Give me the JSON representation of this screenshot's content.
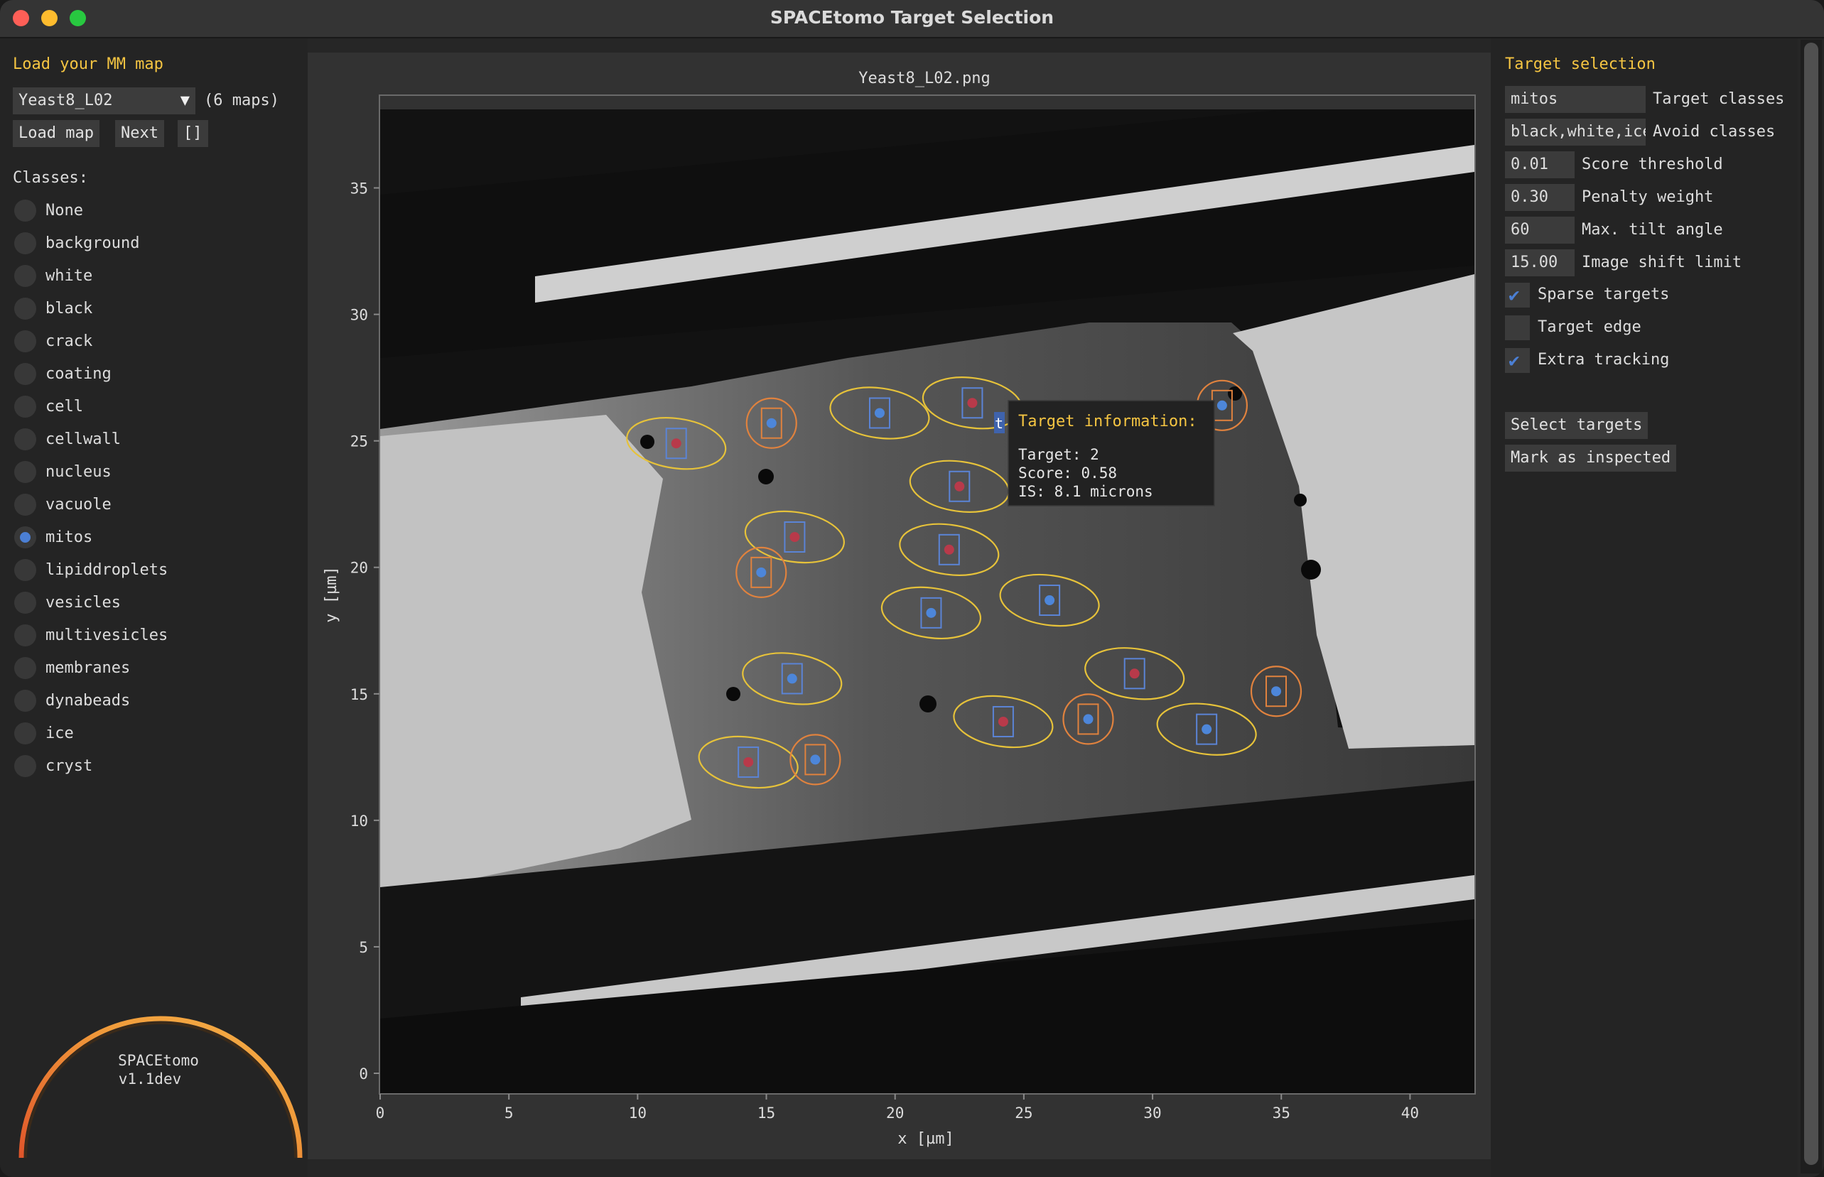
{
  "window": {
    "title": "SPACEtomo Target Selection"
  },
  "left": {
    "load_heading": "Load your MM map",
    "map_select": {
      "value": "Yeast8_L02",
      "arrow": "▼"
    },
    "map_count": "(6 maps)",
    "load_button": "Load map",
    "next_button": "Next",
    "bracket_button": "[]",
    "classes_heading": "Classes:",
    "classes": [
      {
        "label": "None",
        "selected": false
      },
      {
        "label": "background",
        "selected": false
      },
      {
        "label": "white",
        "selected": false
      },
      {
        "label": "black",
        "selected": false
      },
      {
        "label": "crack",
        "selected": false
      },
      {
        "label": "coating",
        "selected": false
      },
      {
        "label": "cell",
        "selected": false
      },
      {
        "label": "cellwall",
        "selected": false
      },
      {
        "label": "nucleus",
        "selected": false
      },
      {
        "label": "vacuole",
        "selected": false
      },
      {
        "label": "mitos",
        "selected": true
      },
      {
        "label": "lipiddroplets",
        "selected": false
      },
      {
        "label": "vesicles",
        "selected": false
      },
      {
        "label": "multivesicles",
        "selected": false
      },
      {
        "label": "membranes",
        "selected": false
      },
      {
        "label": "dynabeads",
        "selected": false
      },
      {
        "label": "ice",
        "selected": false
      },
      {
        "label": "cryst",
        "selected": false
      }
    ],
    "logo": {
      "name": "SPACEtomo",
      "version": "v1.1dev"
    }
  },
  "plot": {
    "title": "Yeast8_L02.png",
    "xlabel": "x [µm]",
    "ylabel": "y [µm]",
    "xticks": [
      "0",
      "5",
      "10",
      "15",
      "20",
      "25",
      "30",
      "35",
      "40"
    ],
    "yticks": [
      "0",
      "5",
      "10",
      "15",
      "20",
      "25",
      "30",
      "35"
    ],
    "tooltip": {
      "heading": "Target information:",
      "lines": [
        "Target: 2",
        "Score: 0.58",
        "IS: 8.1 microns"
      ],
      "marker_letter": "t"
    },
    "colors": {
      "ellipse": "#e6c23a",
      "circle": "#e0823e",
      "box": "#5b84d6",
      "point_blue": "#4d86d9",
      "point_red": "#b83a4a",
      "tooltip_heading": "#f5c542"
    }
  },
  "chart_data": {
    "type": "scatter",
    "title": "Yeast8_L02.png",
    "xlabel": "x [µm]",
    "ylabel": "y [µm]",
    "xlim": [
      0,
      42.5
    ],
    "ylim": [
      0,
      38.3
    ],
    "xticks": [
      0,
      5,
      10,
      15,
      20,
      25,
      30,
      35,
      40
    ],
    "yticks": [
      0,
      5,
      10,
      15,
      20,
      25,
      30,
      35
    ],
    "grid": false,
    "targets": [
      {
        "x": 11.5,
        "y": 24.9,
        "shape": "ellipse",
        "point": "red"
      },
      {
        "x": 15.2,
        "y": 25.7,
        "shape": "circle",
        "point": "blue"
      },
      {
        "x": 19.4,
        "y": 26.1,
        "shape": "ellipse",
        "point": "blue"
      },
      {
        "x": 23.0,
        "y": 26.5,
        "shape": "ellipse",
        "point": "red"
      },
      {
        "x": 32.7,
        "y": 26.4,
        "shape": "circle",
        "point": "blue"
      },
      {
        "x": 22.5,
        "y": 23.2,
        "shape": "ellipse",
        "point": "red"
      },
      {
        "x": 16.1,
        "y": 21.2,
        "shape": "ellipse",
        "point": "red"
      },
      {
        "x": 22.1,
        "y": 20.7,
        "shape": "ellipse",
        "point": "red"
      },
      {
        "x": 14.8,
        "y": 19.8,
        "shape": "circle",
        "point": "blue"
      },
      {
        "x": 21.4,
        "y": 18.2,
        "shape": "ellipse",
        "point": "blue"
      },
      {
        "x": 26.0,
        "y": 18.7,
        "shape": "ellipse",
        "point": "blue"
      },
      {
        "x": 29.3,
        "y": 15.8,
        "shape": "ellipse",
        "point": "red"
      },
      {
        "x": 16.0,
        "y": 15.6,
        "shape": "ellipse",
        "point": "blue"
      },
      {
        "x": 34.8,
        "y": 15.1,
        "shape": "circle",
        "point": "blue"
      },
      {
        "x": 24.2,
        "y": 13.9,
        "shape": "ellipse",
        "point": "red"
      },
      {
        "x": 27.5,
        "y": 14.0,
        "shape": "circle",
        "point": "blue"
      },
      {
        "x": 32.1,
        "y": 13.6,
        "shape": "ellipse",
        "point": "blue"
      },
      {
        "x": 14.3,
        "y": 12.3,
        "shape": "ellipse",
        "point": "red"
      },
      {
        "x": 16.9,
        "y": 12.4,
        "shape": "circle",
        "point": "blue"
      }
    ]
  },
  "right": {
    "heading": "Target selection",
    "target_classes": {
      "value": "mitos",
      "label": "Target classes"
    },
    "avoid_classes": {
      "value": "black,white,ice",
      "label": "Avoid classes"
    },
    "params": [
      {
        "value": "0.01",
        "label": "Score threshold"
      },
      {
        "value": "0.30",
        "label": "Penalty weight"
      },
      {
        "value": "60",
        "label": "Max. tilt angle"
      },
      {
        "value": "15.00",
        "label": "Image shift limit"
      }
    ],
    "checks": [
      {
        "label": "Sparse targets",
        "checked": true
      },
      {
        "label": "Target edge",
        "checked": false
      },
      {
        "label": "Extra tracking",
        "checked": true
      }
    ],
    "checkmark": "✔",
    "select_button": "Select targets",
    "inspected_button": "Mark as inspected"
  }
}
